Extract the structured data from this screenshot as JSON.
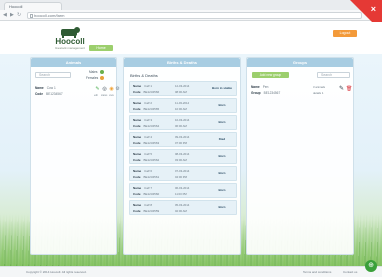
{
  "browser": {
    "tab_title": "Hoocoll",
    "url": "hoocoll.com/farm",
    "nav_back": "◀",
    "nav_forward": "▶",
    "nav_reload": "↻",
    "corner_mark": "×"
  },
  "header": {
    "logo_text": "Hoocoll",
    "logo_tagline": "livestock management",
    "home_button": "Home",
    "action_button": "Logout"
  },
  "left_panel": {
    "title": "Animals",
    "search_placeholder": "Search",
    "filters": [
      {
        "label": "Males",
        "color": "#6ab04c"
      },
      {
        "label": "Females",
        "color": "#e9a23b"
      }
    ],
    "item": {
      "name_label": "Name",
      "name_value": "Cow 1",
      "code_label": "Code",
      "code_value": "BE1234567"
    },
    "actions": [
      {
        "icon": "pencil-icon",
        "glyph": "✎",
        "caption": "edit",
        "color": "#4caf50"
      },
      {
        "icon": "target-icon",
        "glyph": "◎",
        "caption": "status",
        "color": "#2d3c48"
      },
      {
        "icon": "eye-icon",
        "glyph": "◉",
        "caption": "view",
        "color": "#f0a030"
      },
      {
        "icon": "gear-icon",
        "glyph": "⚙",
        "caption": "options",
        "color": "#7c8a94"
      }
    ]
  },
  "mid_panel": {
    "title": "Births & Deaths",
    "subtitle": "Births & Deaths",
    "records": [
      {
        "name": "Calf 1",
        "code": "BE1234566",
        "date1": "12-03-2014",
        "date2": "08:00 AM",
        "tag": "Born in stable"
      },
      {
        "name": "Calf 2",
        "code": "BE1234565",
        "date1": "11-03-2014",
        "date2": "10:00 AM",
        "tag": "Born"
      },
      {
        "name": "Calf 3",
        "code": "BE1234564",
        "date1": "10-03-2014",
        "date2": "06:00 AM",
        "tag": "Born"
      },
      {
        "name": "Calf 4",
        "code": "BE1234563",
        "date1": "09-03-2014",
        "date2": "07:00 PM",
        "tag": "Died"
      },
      {
        "name": "Calf 5",
        "code": "BE1234562",
        "date1": "08-03-2014",
        "date2": "03:00 AM",
        "tag": "Born"
      },
      {
        "name": "Calf 6",
        "code": "BE1234561",
        "date1": "07-03-2014",
        "date2": "04:00 PM",
        "tag": "Born"
      },
      {
        "name": "Calf 7",
        "code": "BE1234560",
        "date1": "06-03-2014",
        "date2": "11:00 PM",
        "tag": "Born"
      },
      {
        "name": "Calf 8",
        "code": "BE1234559",
        "date1": "05-03-2014",
        "date2": "02:00 AM",
        "tag": "Born"
      }
    ],
    "name_label": "Name",
    "code_label": "Code"
  },
  "right_panel": {
    "title": "Groups",
    "add_button": "Add new group",
    "search_placeholder": "Search",
    "item": {
      "name_label": "Name",
      "name_value": "Pen",
      "group_label": "Group",
      "group_value": "BE1234567",
      "side1": "3 animals",
      "side2": "details 1"
    },
    "edit_icon": "pencil-icon",
    "delete_icon": "trash-icon",
    "edit_glyph": "✎",
    "delete_glyph": "🗑"
  },
  "footer": {
    "copyright": "Copyright © 2014 Hoocoll. All rights reserved.",
    "links": [
      "Terms and conditions",
      "Contact us"
    ],
    "fab_glyph": "⊕"
  },
  "colors": {
    "accent_green": "#9ccf6d",
    "accent_orange": "#f39a3a",
    "panel_header": "#a8cde2"
  }
}
